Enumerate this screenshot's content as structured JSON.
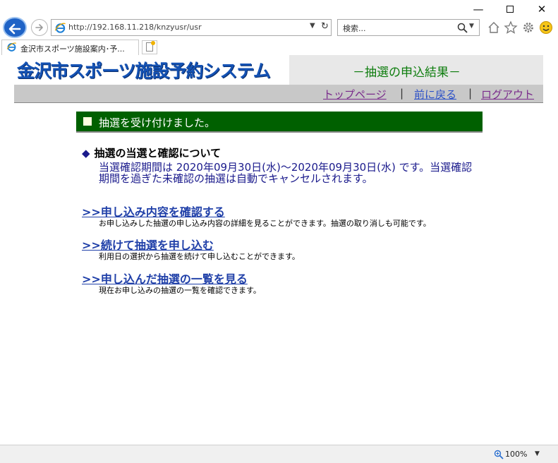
{
  "browser": {
    "address": "http://192.168.11.218/knzyusr/usr",
    "search_placeholder": "検索...",
    "tab_title": "金沢市スポーツ施設案内･予...",
    "zoom": "100%",
    "window_buttons": {
      "minimize": "—",
      "close": "✕"
    },
    "icons": [
      "back-icon",
      "forward-icon",
      "ie-icon",
      "refresh-icon",
      "search-icon",
      "home-icon",
      "favorites-icon",
      "settings-icon",
      "feedback-icon",
      "zoom-icon"
    ]
  },
  "header": {
    "logo_text": "金沢市スポーツ施設予約システム",
    "page_title": "－抽選の申込結果－"
  },
  "nav": {
    "top": "トップページ",
    "back": "前に戻る",
    "logout": "ログアウト",
    "separator": "|"
  },
  "notice": {
    "text": "抽選を受け付けました。"
  },
  "info": {
    "heading": "抽選の当選と確認について",
    "body": "当選確認期間は 2020年09月30日(水)～2020年09月30日(水) です。当選確認期間を過ぎた未確認の抽選は自動でキャンセルされます。"
  },
  "links": [
    {
      "label": ">>申し込み内容を確認する",
      "desc": "お申し込みした抽選の申し込み内容の詳細を見ることができます。抽選の取り消しも可能です。"
    },
    {
      "label": ">>続けて抽選を申し込む",
      "desc": "利用日の選択から抽選を続けて申し込むことができます。"
    },
    {
      "label": ">>申し込んだ抽選の一覧を見る",
      "desc": "現在お申し込みの抽選の一覧を確認できます。"
    }
  ]
}
